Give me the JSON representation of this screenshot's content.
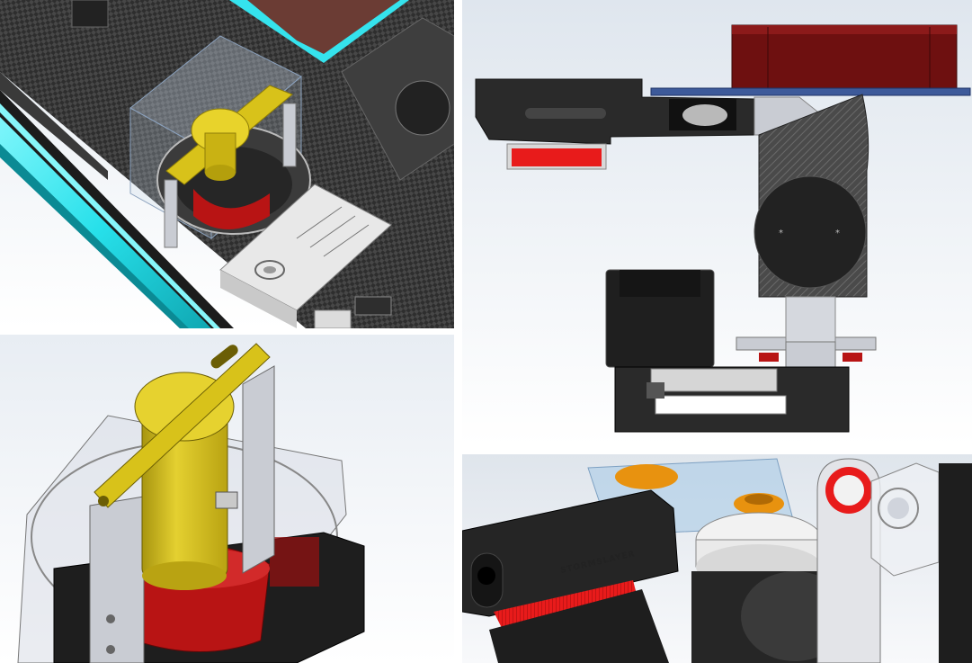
{
  "panels": {
    "top_left": {
      "name": "iso-view-with-carbon-plate"
    },
    "top_right": {
      "name": "side-section-view"
    },
    "bottom_left": {
      "name": "gimbal-motor-closeup"
    },
    "bottom_right": {
      "name": "pitch-assembly-render"
    }
  },
  "labels": {
    "engraving": "STORMSLAYER"
  },
  "colors": {
    "carbon": "#2b2b2b",
    "cyan_tube": "#27e0ea",
    "gold": "#d8c21a",
    "red": "#b81414",
    "dark_red": "#6e1010",
    "bright_red": "#e81b1b",
    "orange": "#e8920f",
    "grey_metal": "#c9ccd3",
    "dark_body": "#202020",
    "sky_top": "#e6ecf2",
    "sky_bottom": "#ffffff"
  }
}
